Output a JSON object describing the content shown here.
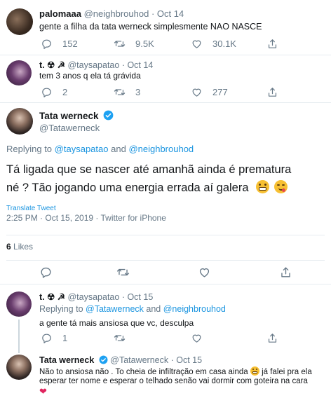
{
  "tweet1": {
    "display_name": "palomaaa",
    "handle": "@neighbrouhod",
    "date": "· Oct 14",
    "text": "gente a filha da tata werneck simplesmente NAO NASCE",
    "replies": "152",
    "retweets": "9.5K",
    "likes": "30.1K"
  },
  "tweet2": {
    "display_name": "t. ☢ ☭",
    "handle": "@taysapatao",
    "date": "· Oct 14",
    "text": "tem 3 anos q ela tá grávida",
    "replies": "2",
    "retweets": "3",
    "likes": "277"
  },
  "main": {
    "display_name": "Tata werneck",
    "handle": "@Tatawerneck",
    "replying_prefix": "Replying to",
    "replying_to_1": "@taysapatao",
    "replying_and": "and",
    "replying_to_2": "@neighbrouhod",
    "text_line1": "Tá ligada que se nascer até amanhã ainda é prematura",
    "text_line2": "né ? Tão jogando uma energia errada aí galera",
    "translate": "Translate Tweet",
    "timestamp": "2:25 PM · Oct 15, 2019 · ",
    "source": "Twitter for iPhone",
    "likes_count": "6",
    "likes_label": "Likes"
  },
  "tweet3": {
    "display_name": "t. ☢ ☭",
    "handle": "@taysapatao",
    "date": "· Oct 15",
    "replying_prefix": "Replying to",
    "replying_to_1": "@Tatawerneck",
    "replying_and": "and",
    "replying_to_2": "@neighbrouhod",
    "text": "a gente tá mais ansiosa que vc, desculpa",
    "replies": "1"
  },
  "tweet4": {
    "display_name": "Tata werneck",
    "handle": "@Tatawerneck",
    "date": "· Oct 15",
    "text_line1": "Não to ansiosa não . To cheia de infiltração em casa ainda",
    "text_line1b": "já falei pra ela",
    "text_line2": "esperar ter nome e esperar o telhado senão vai dormir com goteira na cara"
  },
  "colors": {
    "accent": "#1b95e0",
    "verified": "#1da1f2",
    "muted": "#657786",
    "divider": "#e6ecf0"
  }
}
